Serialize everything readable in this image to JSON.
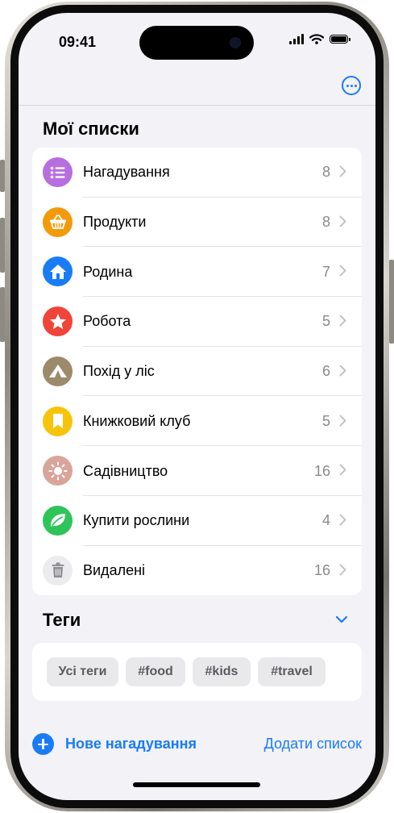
{
  "status_bar": {
    "time": "09:41"
  },
  "sections": {
    "my_lists": "Мої списки",
    "tags": "Теги"
  },
  "lists": [
    {
      "name": "Нагадування",
      "count": "8",
      "icon": "list-bullet-icon",
      "color": "#b76fe0"
    },
    {
      "name": "Продукти",
      "count": "8",
      "icon": "basket-icon",
      "color": "#f39a0b"
    },
    {
      "name": "Родина",
      "count": "7",
      "icon": "house-icon",
      "color": "#1a7cf5"
    },
    {
      "name": "Робота",
      "count": "5",
      "icon": "star-icon",
      "color": "#f0443a"
    },
    {
      "name": "Похід у ліс",
      "count": "6",
      "icon": "tent-icon",
      "color": "#9c8a6a"
    },
    {
      "name": "Книжковий клуб",
      "count": "5",
      "icon": "bookmark-icon",
      "color": "#f7c40c"
    },
    {
      "name": "Садівництво",
      "count": "16",
      "icon": "sun-icon",
      "color": "#d9a49a"
    },
    {
      "name": "Купити рослини",
      "count": "4",
      "icon": "leaf-icon",
      "color": "#2fc45a"
    },
    {
      "name": "Видалені",
      "count": "16",
      "icon": "trash-icon",
      "color": "#ececef"
    }
  ],
  "tags": [
    {
      "label": "Усі теги"
    },
    {
      "label": "#food"
    },
    {
      "label": "#kids"
    },
    {
      "label": "#travel"
    }
  ],
  "toolbar": {
    "new_reminder": "Нове нагадування",
    "add_list": "Додати список"
  },
  "colors": {
    "accent": "#1a7cf5",
    "background": "#f2f2f7"
  }
}
